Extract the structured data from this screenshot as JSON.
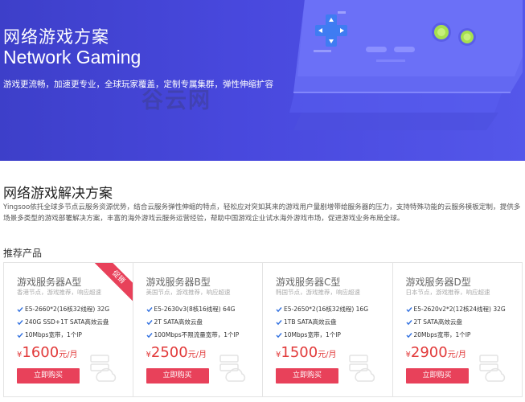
{
  "hero": {
    "title_cn": "网络游戏方案",
    "title_en": "Network Gaming",
    "description": "游戏更流畅，加速更专业，全球玩家覆盖，定制专属集群，弹性伸缩扩容",
    "watermark": "谷云网"
  },
  "solution": {
    "title": "网络游戏解决方案",
    "description": "Yingsoo依托全球多节点云服务资源优势，结合云服务弹性伸缩的特点，轻松应对突如其来的游戏用户量剧增带给服务器的压力，支持特殊功能的云服务模板定制，提供多场景多类型的游戏部署解决方案，丰富的海外游戏云服务运营经验，帮助中国游戏企业试水海外游戏市场，促进游戏业务布局全球。"
  },
  "products": {
    "title": "推荐产品",
    "items": [
      {
        "name": "游戏服务器A型",
        "sub": "香港节点，游戏推荐，响应超速",
        "badge": "促销",
        "specs": [
          "E5-2660*2(16核32线程) 32G",
          "240G SSD+1T SATA高效云盘",
          "10Mbps宽带，1个IP"
        ],
        "currency": "¥",
        "price": "1600",
        "unit": "元/月",
        "button": "立即购买"
      },
      {
        "name": "游戏服务器B型",
        "sub": "美国节点，游戏推荐，响应超速",
        "badge": "",
        "specs": [
          "E5-2630v3(8核16线程) 64G",
          "2T SATA高效云盘",
          "100Mbps不限流量宽带，1个IP"
        ],
        "currency": "¥",
        "price": "2500",
        "unit": "元/月",
        "button": "立即购买"
      },
      {
        "name": "游戏服务器C型",
        "sub": "韩国节点，游戏推荐，响应超速",
        "badge": "",
        "specs": [
          "E5-2650*2(16核32线程) 16G",
          "1TB SATA高效云盘",
          "10Mbps宽带，1个IP"
        ],
        "currency": "¥",
        "price": "1500",
        "unit": "元/月",
        "button": "立即购买"
      },
      {
        "name": "游戏服务器D型",
        "sub": "日本节点，游戏推荐，响应超速",
        "badge": "",
        "specs": [
          "E5-2620v2*2(12核24线程) 32G",
          "2T SATA高效云盘",
          "20Mbps宽带，1个IP"
        ],
        "currency": "¥",
        "price": "2900",
        "unit": "元/月",
        "button": "立即购买"
      }
    ]
  },
  "colors": {
    "hero_bg": "#4444d6",
    "accent_red": "#e8415a",
    "price_red": "#e23a3a",
    "check_blue": "#2f6fe0"
  },
  "icons": [
    "gamepad-console-illustration",
    "check-icon",
    "cloud-server-icon"
  ]
}
